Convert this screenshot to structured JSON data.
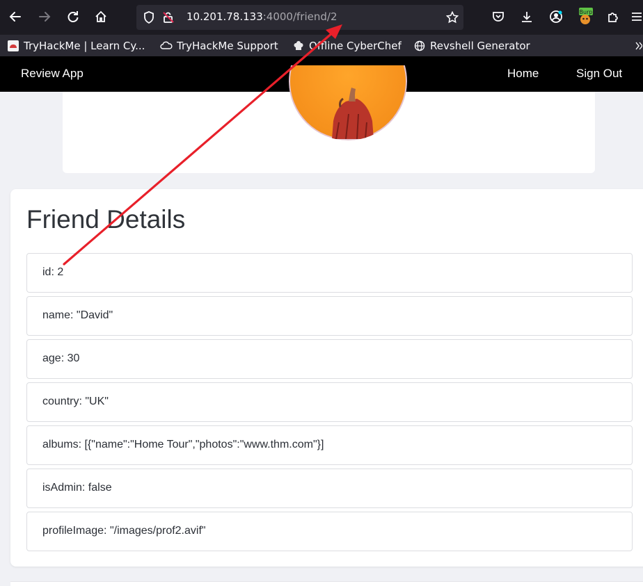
{
  "browser": {
    "url_host": "10.201.78.133",
    "url_path": ":4000/friend/2",
    "extension_badge": "Burp"
  },
  "bookmarks": [
    {
      "label": "TryHackMe | Learn Cy..."
    },
    {
      "label": "TryHackMe Support"
    },
    {
      "label": "Offline CyberChef"
    },
    {
      "label": "Revshell Generator"
    }
  ],
  "app": {
    "brand": "Review App",
    "nav": {
      "home": "Home",
      "sign_out": "Sign Out"
    }
  },
  "details": {
    "title": "Friend Details",
    "fields": [
      {
        "text": "id: 2"
      },
      {
        "text": "name: \"David\""
      },
      {
        "text": "age: 30"
      },
      {
        "text": "country: \"UK\""
      },
      {
        "text": "albums: [{\"name\":\"Home Tour\",\"photos\":\"www.thm.com\"}]"
      },
      {
        "text": "isAdmin: false"
      },
      {
        "text": "profileImage: \"/images/prof2.avif\""
      }
    ]
  },
  "colors": {
    "annotation_arrow": "#e8202a",
    "navbar": "#000000",
    "avatar": "#f7931e"
  }
}
